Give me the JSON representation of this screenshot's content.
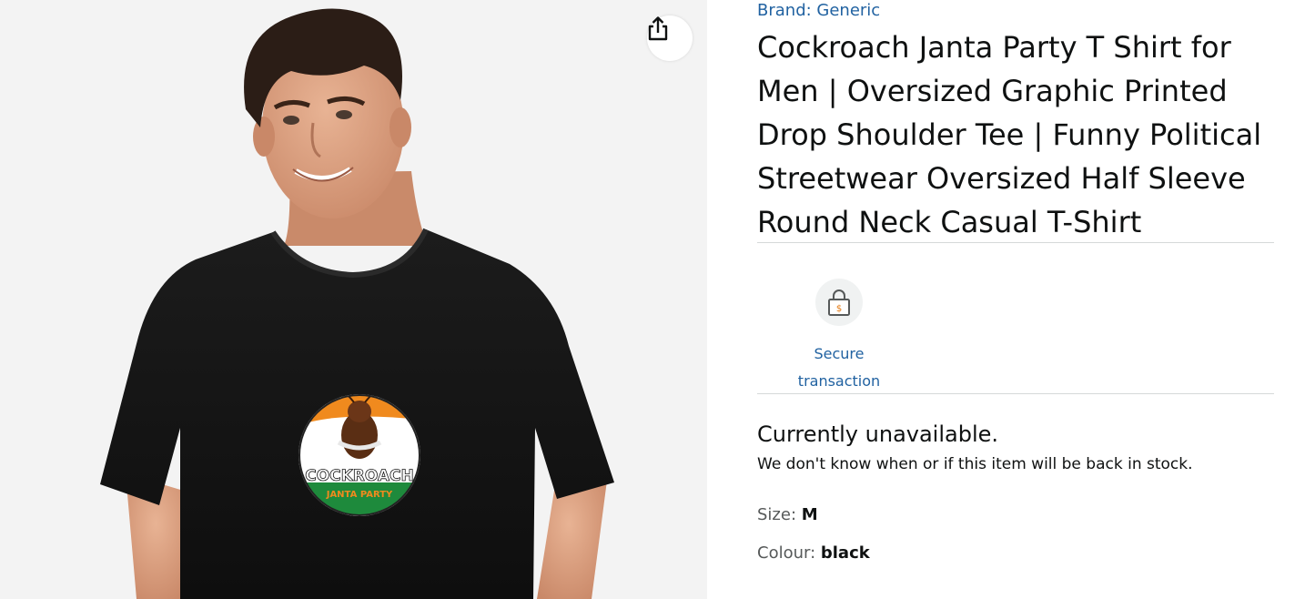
{
  "product": {
    "brand_link": "Brand: Generic",
    "title": "Cockroach Janta Party T Shirt for Men | Oversized Graphic Printed Drop Shoulder Tee | Funny Political Streetwear Oversized Half Sleeve Round Neck Casual T-Shirt",
    "image": {
      "logo_text_main": "COCKROACH",
      "logo_text_sub": "JANTA PARTY"
    }
  },
  "badges": {
    "secure": {
      "line1": "Secure",
      "line2": "transaction",
      "icon": "lock-icon"
    }
  },
  "availability": {
    "status": "Currently unavailable.",
    "note": "We don't know when or if this item will be back in stock."
  },
  "variations": {
    "size_label": "Size: ",
    "size_value": "M",
    "colour_label": "Colour: ",
    "colour_value": "black"
  },
  "actions": {
    "share_icon": "share-icon"
  },
  "colors": {
    "link": "#2162a1",
    "text": "#0f1111",
    "muted": "#565959",
    "divider": "#d5d9d9",
    "saffron": "#f08a1e",
    "green": "#1e8a3c"
  }
}
